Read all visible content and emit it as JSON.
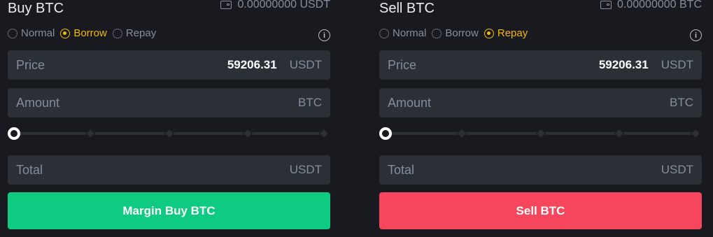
{
  "buy": {
    "title": "Buy BTC",
    "balance": "0.00000000 USDT",
    "modes": [
      "Normal",
      "Borrow",
      "Repay"
    ],
    "selected_mode": "Borrow",
    "price": {
      "label": "Price",
      "value": "59206.31",
      "unit": "USDT"
    },
    "amount": {
      "label": "Amount",
      "unit": "BTC"
    },
    "slider": {
      "value_percent": 0,
      "stops": [
        0,
        25,
        50,
        75,
        100
      ]
    },
    "total": {
      "label": "Total",
      "unit": "USDT"
    },
    "submit_label": "Margin Buy BTC"
  },
  "sell": {
    "title": "Sell BTC",
    "balance": "0.00000000 BTC",
    "modes": [
      "Normal",
      "Borrow",
      "Repay"
    ],
    "selected_mode": "Repay",
    "price": {
      "label": "Price",
      "value": "59206.31",
      "unit": "USDT"
    },
    "amount": {
      "label": "Amount",
      "unit": "BTC"
    },
    "slider": {
      "value_percent": 0,
      "stops": [
        0,
        25,
        50,
        75,
        100
      ]
    },
    "total": {
      "label": "Total",
      "unit": "USDT"
    },
    "submit_label": "Sell BTC"
  },
  "colors": {
    "background": "#181a20",
    "field_bg": "#2b2f36",
    "accent": "#f0b90b",
    "buy": "#0ecb81",
    "sell": "#f6465d",
    "muted_text": "#848e9c"
  },
  "icons": {
    "balance": "wallet-icon",
    "info": "info-icon"
  }
}
